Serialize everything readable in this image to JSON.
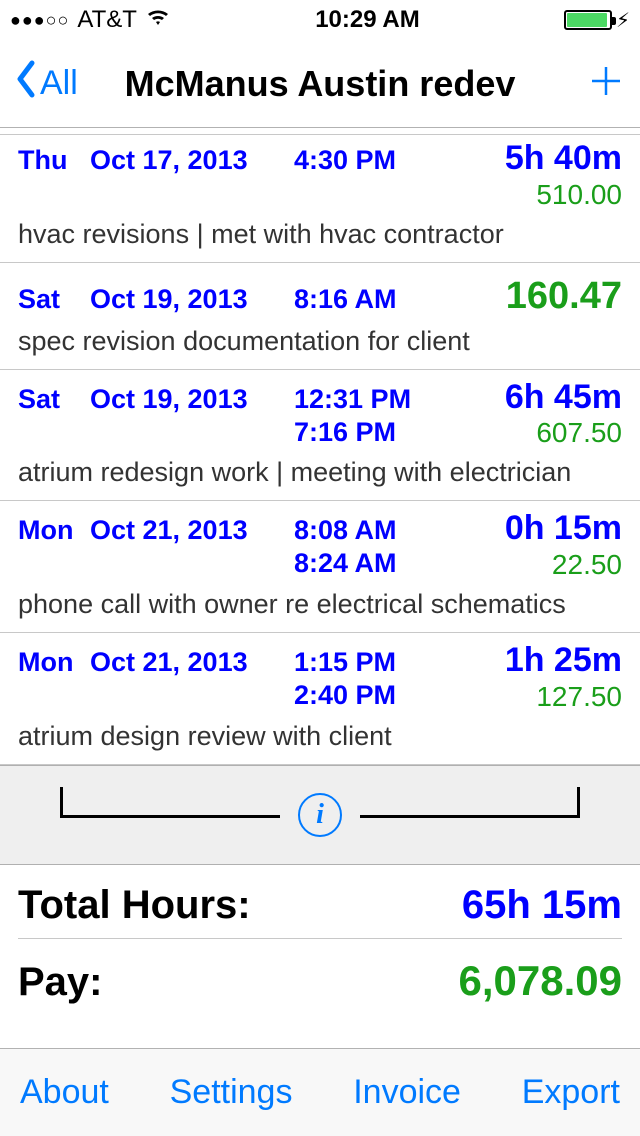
{
  "status": {
    "signal_dots": "●●●○○",
    "carrier": "AT&T",
    "time": "10:29 AM"
  },
  "nav": {
    "back_label": "All",
    "title": "McManus Austin redev"
  },
  "entries": [
    {
      "day": "Thu",
      "date": "Oct 17, 2013",
      "start": "4:30 PM",
      "end": "",
      "duration": "5h 40m",
      "amount": "510.00",
      "desc": "hvac revisions | met with hvac contractor",
      "compact_top": true
    },
    {
      "day": "Sat",
      "date": "Oct 19, 2013",
      "start": "8:16 AM",
      "end": "",
      "duration": "",
      "amount": "160.47",
      "desc": "spec revision documentation for client",
      "single": true
    },
    {
      "day": "Sat",
      "date": "Oct 19, 2013",
      "start": "12:31 PM",
      "end": "7:16 PM",
      "duration": "6h 45m",
      "amount": "607.50",
      "desc": "atrium redesign work | meeting with electrician"
    },
    {
      "day": "Mon",
      "date": "Oct 21, 2013",
      "start": "8:08 AM",
      "end": "8:24 AM",
      "duration": "0h 15m",
      "amount": "22.50",
      "desc": "phone call with owner re electrical schematics"
    },
    {
      "day": "Mon",
      "date": "Oct 21, 2013",
      "start": "1:15 PM",
      "end": "2:40 PM",
      "duration": "1h 25m",
      "amount": "127.50",
      "desc": "atrium design review with client"
    }
  ],
  "totals": {
    "hours_label": "Total Hours:",
    "hours_value": "65h 15m",
    "pay_label": "Pay:",
    "pay_value": "6,078.09"
  },
  "toolbar": {
    "about": "About",
    "settings": "Settings",
    "invoice": "Invoice",
    "export": "Export"
  },
  "info_char": "i"
}
